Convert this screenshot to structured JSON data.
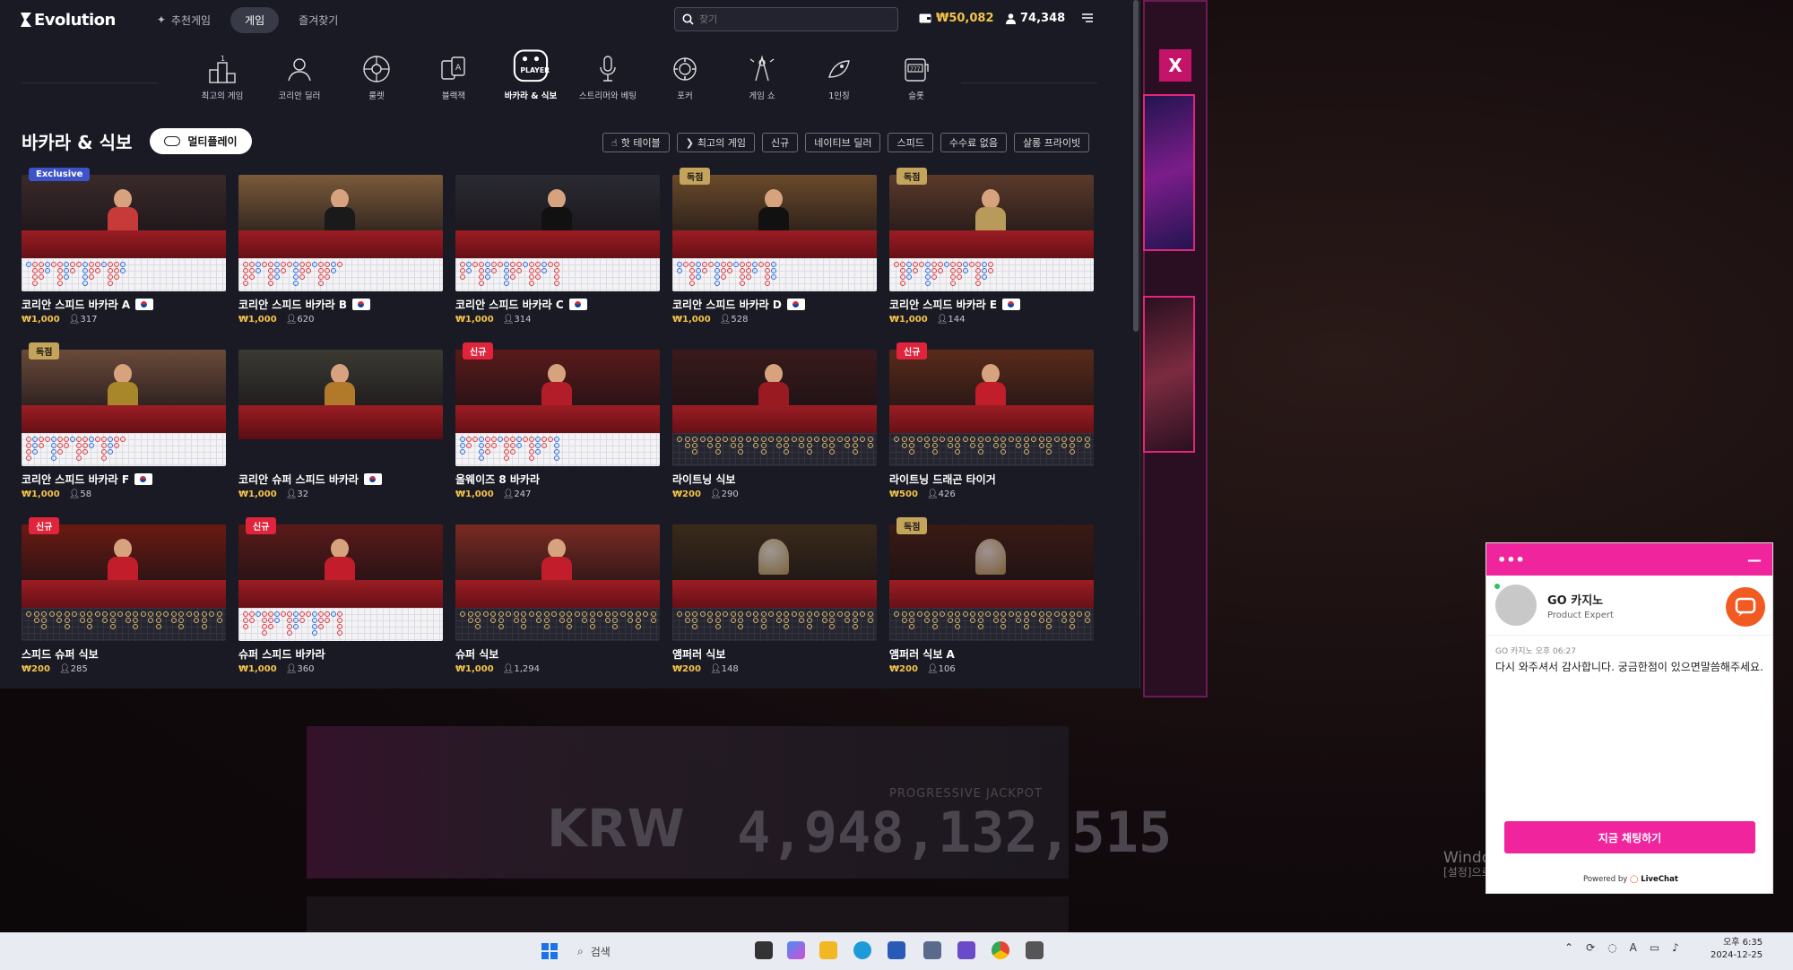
{
  "app": {
    "logo": "Evolution",
    "nav": [
      {
        "label": "추천게임",
        "active": false
      },
      {
        "label": "게임",
        "active": true
      },
      {
        "label": "즐겨찾기",
        "active": false
      }
    ],
    "search_placeholder": "찾기",
    "balance": "₩50,082",
    "players": "74,348"
  },
  "categories": [
    {
      "label": "최고의 게임",
      "icon": "podium-icon"
    },
    {
      "label": "코리안 딜러",
      "icon": "dealer-icon"
    },
    {
      "label": "룰렛",
      "icon": "roulette-icon"
    },
    {
      "label": "블랙잭",
      "icon": "cards-icon"
    },
    {
      "label": "바카라 & 식보",
      "icon": "baccarat-player-icon",
      "active": true
    },
    {
      "label": "스트리머와 베팅",
      "icon": "microphone-icon"
    },
    {
      "label": "포커",
      "icon": "poker-chips-icon"
    },
    {
      "label": "게임 쇼",
      "icon": "game-show-icon"
    },
    {
      "label": "1인칭",
      "icon": "first-person-icon"
    },
    {
      "label": "슬롯",
      "icon": "slot-machine-icon"
    }
  ],
  "section": {
    "title": "바카라 & 식보",
    "multiplay": "멀티플레이",
    "filters": [
      "핫 테이블",
      "최고의 게임",
      "신규",
      "네이티브 딜러",
      "스피드",
      "수수료 없음",
      "살롱 프라이빗"
    ]
  },
  "games": [
    {
      "name": "코리안 스피드 바카라 A",
      "flag": true,
      "bet": "₩1,000",
      "players": "317",
      "badge": "Exclusive",
      "badge_type": "ex",
      "road": "light",
      "bg": "#3a2a2a",
      "dealer": "#c73a3a"
    },
    {
      "name": "코리안 스피드 바카라 B",
      "flag": true,
      "bet": "₩1,000",
      "players": "620",
      "badge": "",
      "badge_type": "",
      "road": "light",
      "bg": "#7a5a3a",
      "dealer": "#1a1a1a"
    },
    {
      "name": "코리안 스피드 바카라 C",
      "flag": true,
      "bet": "₩1,000",
      "players": "314",
      "badge": "",
      "badge_type": "",
      "road": "light",
      "bg": "#2a2a32",
      "dealer": "#111111"
    },
    {
      "name": "코리안 스피드 바카라 D",
      "flag": true,
      "bet": "₩1,000",
      "players": "528",
      "badge": "독점",
      "badge_type": "dj",
      "road": "light",
      "bg": "#6a4a2a",
      "dealer": "#111111"
    },
    {
      "name": "코리안 스피드 바카라 E",
      "flag": true,
      "bet": "₩1,000",
      "players": "144",
      "badge": "독점",
      "badge_type": "dj",
      "road": "light",
      "bg": "#5a3a2a",
      "dealer": "#b89a5a"
    },
    {
      "name": "코리안 스피드 바카라 F",
      "flag": true,
      "bet": "₩1,000",
      "players": "58",
      "badge": "독점",
      "badge_type": "dj",
      "road": "light",
      "bg": "#6a4a3a",
      "dealer": "#a8872a"
    },
    {
      "name": "코리안 슈퍼 스피드 바카라",
      "flag": true,
      "bet": "₩1,000",
      "players": "32",
      "badge": "",
      "badge_type": "",
      "road": "none",
      "bg": "#3a3a32",
      "dealer": "#b07a2a"
    },
    {
      "name": "올웨이즈 8 바카라",
      "flag": false,
      "bet": "₩1,000",
      "players": "247",
      "badge": "신규",
      "badge_type": "new",
      "road": "light",
      "bg": "#5a1a1a",
      "dealer": "#b31d2a"
    },
    {
      "name": "라이트닝 식보",
      "flag": false,
      "bet": "₩200",
      "players": "290",
      "badge": "",
      "badge_type": "",
      "road": "dark",
      "bg": "#3a1a1a",
      "dealer": "#9a1a22"
    },
    {
      "name": "라이트닝 드래곤 타이거",
      "flag": false,
      "bet": "₩500",
      "players": "426",
      "badge": "신규",
      "badge_type": "new",
      "road": "dark",
      "bg": "#5a2a1a",
      "dealer": "#c21d2a"
    },
    {
      "name": "스피드 슈퍼 식보",
      "flag": false,
      "bet": "₩200",
      "players": "285",
      "badge": "신규",
      "badge_type": "new",
      "road": "dark",
      "bg": "#6a1a12",
      "dealer": "#c21d2a"
    },
    {
      "name": "슈퍼 스피드 바카라",
      "flag": false,
      "bet": "₩1,000",
      "players": "360",
      "badge": "신규",
      "badge_type": "new",
      "road": "light",
      "bg": "#5a1a18",
      "dealer": "#c21d2a"
    },
    {
      "name": "슈퍼 식보",
      "flag": false,
      "bet": "₩1,000",
      "players": "1,294",
      "badge": "",
      "badge_type": "",
      "road": "dark",
      "bg": "#7a2a22",
      "dealer": "#c21d2a"
    },
    {
      "name": "앰퍼러 식보",
      "flag": false,
      "bet": "₩200",
      "players": "148",
      "badge": "",
      "badge_type": "",
      "road": "dark",
      "bg": "#3a2a1a",
      "dealer": ""
    },
    {
      "name": "앰퍼러 식보 A",
      "flag": false,
      "bet": "₩200",
      "players": "106",
      "badge": "독점",
      "badge_type": "dj",
      "road": "dark",
      "bg": "#3a1a14",
      "dealer": ""
    }
  ],
  "background": {
    "close": "X",
    "jackpot_label": "PROGRESSIVE JACKPOT",
    "currency": "KRW",
    "jackpot_amount": "4,948,132,515",
    "watermark_1": "Windows 정품 인증",
    "watermark_2": "[설정]으로 이동하여 Windows를 정품 인증합니다."
  },
  "chat": {
    "agent_name": "GO 카지노",
    "agent_role": "Product Expert",
    "timestamp": "GO 카지노 오후 06:27",
    "message": "다시 와주셔서 감사합니다. 궁금한점이 있으면말씀해주세요.",
    "start_button": "지금 채팅하기",
    "powered": "Powered by",
    "brand": "LiveChat"
  },
  "taskbar": {
    "search": "검색",
    "tray_lang": "A",
    "time": "오후 6:35",
    "date": "2024-12-25"
  },
  "colors": {
    "accent_pink": "#f0249c",
    "gold": "#f3c34a",
    "panel": "#191a24"
  }
}
